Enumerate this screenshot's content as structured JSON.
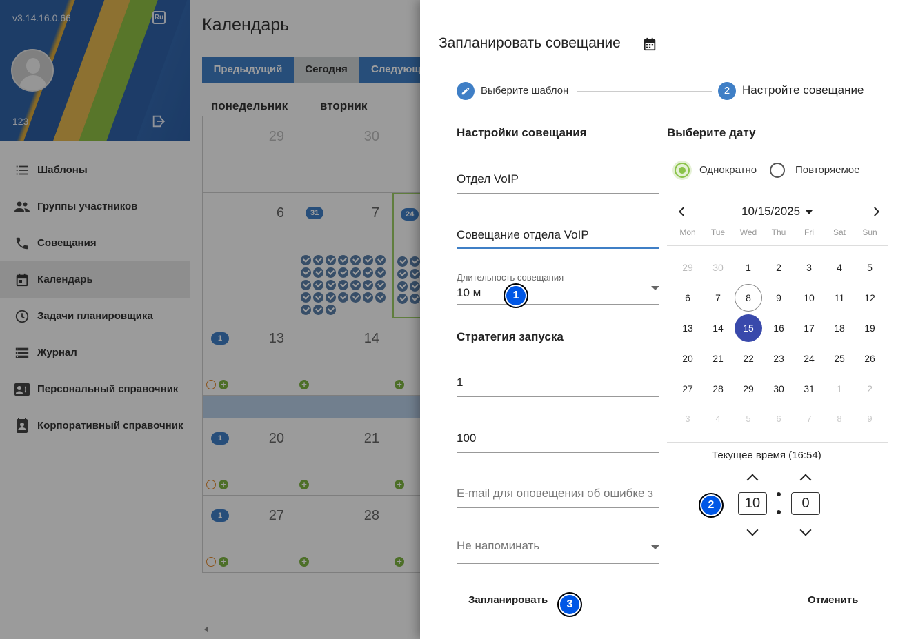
{
  "sidebar": {
    "version": "v3.14.16.0.66",
    "lang": "Ru",
    "user": "123",
    "items": [
      {
        "label": "Шаблоны",
        "icon": "list-icon"
      },
      {
        "label": "Группы участников",
        "icon": "group-icon"
      },
      {
        "label": "Совещания",
        "icon": "phone-icon"
      },
      {
        "label": "Календарь",
        "icon": "calendar-icon",
        "active": true
      },
      {
        "label": "Задачи планировщика",
        "icon": "clock-icon"
      },
      {
        "label": "Журнал",
        "icon": "storage-icon"
      },
      {
        "label": "Персональный справочник",
        "icon": "contact-phone-icon"
      },
      {
        "label": "Корпоративный справочник",
        "icon": "contact-book-icon"
      }
    ]
  },
  "calendar": {
    "title": "Календарь",
    "prev": "Предыдущий",
    "today": "Сегодня",
    "next": "Следующ",
    "weekdays": [
      "понедельник",
      "вторник"
    ],
    "rows": [
      [
        "29",
        "30",
        ""
      ],
      [
        "6",
        "7",
        ""
      ],
      [
        "13",
        "14",
        ""
      ],
      [
        "20",
        "21",
        ""
      ],
      [
        "27",
        "28",
        ""
      ]
    ],
    "badges": {
      "tue_row2": "31",
      "wed_row2": "24",
      "mon_row3": "1",
      "mon_row4": "1",
      "mon_row5": "1"
    }
  },
  "dialog": {
    "title": "Запланировать совещание",
    "title_icon": "calendar-icon",
    "steps": [
      {
        "num": "1",
        "label": "Выберите шаблон",
        "icon": "pencil-icon"
      },
      {
        "num": "2",
        "label": "Настройте совещание"
      }
    ],
    "settings_title": "Настройки совещания",
    "department": "Отдел VoIP",
    "meeting_name": "Совещание отдела VoIP",
    "duration_label": "Длительность совещания",
    "duration_value": "10 м",
    "strategy_title": "Стратегия запуска",
    "strategy_value_1": "1",
    "strategy_value_2": "100",
    "email_placeholder": "E-mail для оповещения об ошибке з",
    "reminder_value": "Не напоминать",
    "date_title": "Выберите дату",
    "radio_once": "Однократно",
    "radio_repeat": "Повторяемое",
    "month_label": "10/15/2025",
    "weekdays": [
      "Mon",
      "Tue",
      "Wed",
      "Thu",
      "Fri",
      "Sat",
      "Sun"
    ],
    "days": [
      [
        "29",
        "30",
        "1",
        "2",
        "3",
        "4",
        "5"
      ],
      [
        "6",
        "7",
        "8",
        "9",
        "10",
        "11",
        "12"
      ],
      [
        "13",
        "14",
        "15",
        "16",
        "17",
        "18",
        "19"
      ],
      [
        "20",
        "21",
        "22",
        "23",
        "24",
        "25",
        "26"
      ],
      [
        "27",
        "28",
        "29",
        "30",
        "31",
        "1",
        "2"
      ],
      [
        "3",
        "4",
        "5",
        "6",
        "7",
        "8",
        "9"
      ]
    ],
    "today_day": "8",
    "selected_day": "15",
    "current_time_label": "Текущее время (16:54)",
    "hour": "10",
    "minute": "0",
    "schedule_button": "Запланировать",
    "cancel_button": "Отменить",
    "markers": [
      "1",
      "2",
      "3"
    ]
  }
}
